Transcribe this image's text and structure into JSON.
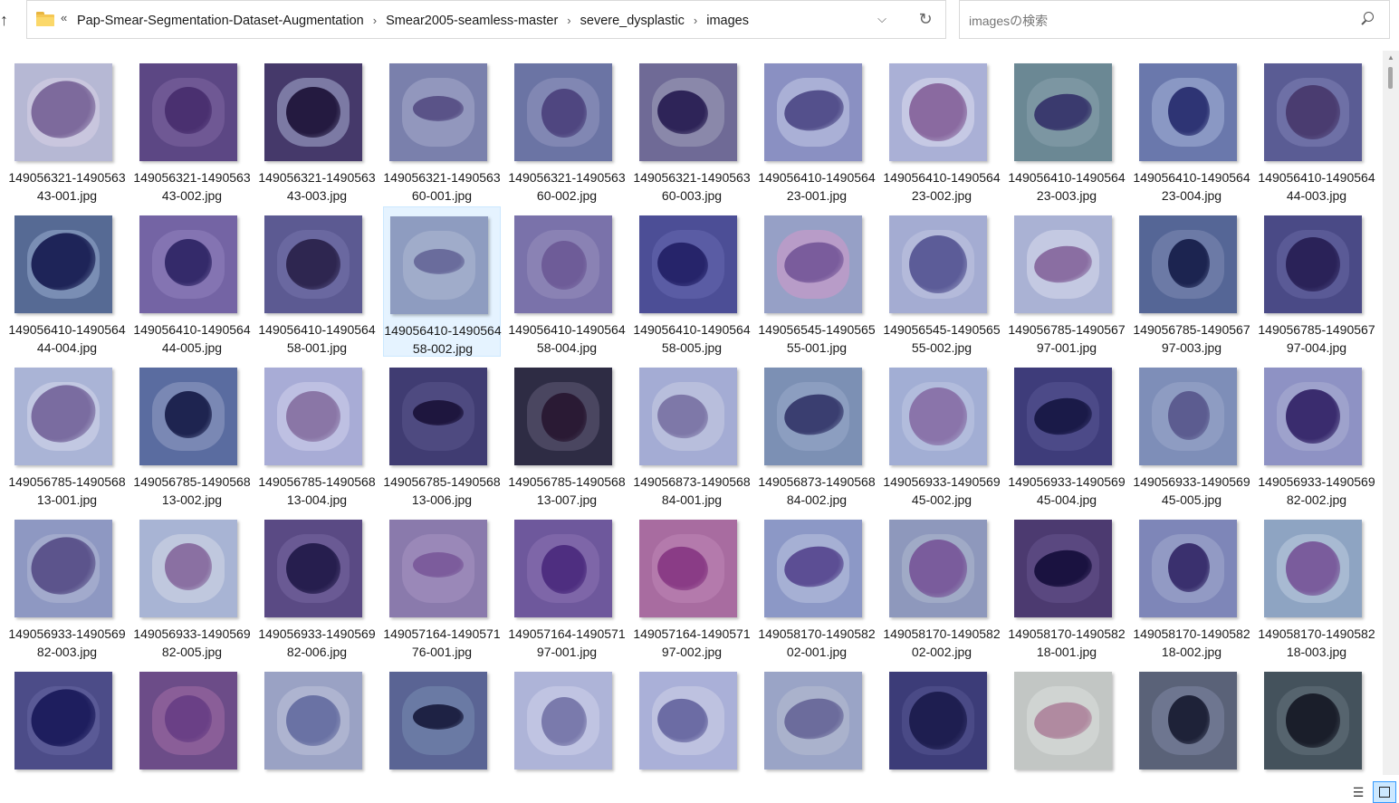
{
  "toolbar": {
    "up_icon": "up-arrow-icon",
    "overflow_chevron": "«",
    "breadcrumb": [
      "Pap-Smear-Segmentation-Dataset-Augmentation",
      "Smear2005-seamless-master",
      "severe_dysplastic",
      "images"
    ],
    "search_placeholder": "imagesの検索"
  },
  "view": {
    "mode": "large-icons",
    "selected_index": 14
  },
  "files": [
    {
      "name": "149056321-149056343-001.jpg",
      "bg": "#b6b8d4",
      "cell": "#c9c6de",
      "nuc": "#7d6a9c"
    },
    {
      "name": "149056321-149056343-002.jpg",
      "bg": "#5c4784",
      "cell": "#6f5894",
      "nuc": "#4a3070"
    },
    {
      "name": "149056321-149056343-003.jpg",
      "bg": "#45396a",
      "cell": "#7c7aa4",
      "nuc": "#241a40"
    },
    {
      "name": "149056321-149056360-001.jpg",
      "bg": "#7a80ac",
      "cell": "#9297bd",
      "nuc": "#5a5388"
    },
    {
      "name": "149056321-149056360-002.jpg",
      "bg": "#6b74a4",
      "cell": "#8187b3",
      "nuc": "#4f4680"
    },
    {
      "name": "149056321-149056360-003.jpg",
      "bg": "#6f6a96",
      "cell": "#8a88aa",
      "nuc": "#2e2458"
    },
    {
      "name": "149056410-149056423-001.jpg",
      "bg": "#8a90c2",
      "cell": "#aab0d6",
      "nuc": "#54508c"
    },
    {
      "name": "149056410-149056423-002.jpg",
      "bg": "#aab0d6",
      "cell": "#c6c9e4",
      "nuc": "#8a6aa0"
    },
    {
      "name": "149056410-149056423-003.jpg",
      "bg": "#6b8894",
      "cell": "#7c96a2",
      "nuc": "#3a3a6e"
    },
    {
      "name": "149056410-149056423-004.jpg",
      "bg": "#6a78ac",
      "cell": "#8a98c4",
      "nuc": "#2e3474"
    },
    {
      "name": "149056410-149056444-003.jpg",
      "bg": "#5a5c94",
      "cell": "#6e70a6",
      "nuc": "#4a3c70"
    },
    {
      "name": "149056410-149056444-004.jpg",
      "bg": "#566a94",
      "cell": "#7a8eb4",
      "nuc": "#1e2458"
    },
    {
      "name": "149056410-149056444-005.jpg",
      "bg": "#7464a4",
      "cell": "#8474b2",
      "nuc": "#342a6a"
    },
    {
      "name": "149056410-149056458-001.jpg",
      "bg": "#5c5a92",
      "cell": "#6a68a0",
      "nuc": "#2e2650"
    },
    {
      "name": "149056410-149056458-002.jpg",
      "bg": "#8e9cc0",
      "cell": "#a0acca",
      "nuc": "#6a6c9c"
    },
    {
      "name": "149056410-149056458-004.jpg",
      "bg": "#7a72aa",
      "cell": "#8a82b4",
      "nuc": "#6e5c98"
    },
    {
      "name": "149056410-149056458-005.jpg",
      "bg": "#4c4e96",
      "cell": "#5a5ca4",
      "nuc": "#26246a"
    },
    {
      "name": "149056545-149056555-001.jpg",
      "bg": "#96a0c6",
      "cell": "#b89cc8",
      "nuc": "#7a5c9c"
    },
    {
      "name": "149056545-149056555-002.jpg",
      "bg": "#a4acd2",
      "cell": "#b4bada",
      "nuc": "#5c5c98"
    },
    {
      "name": "149056785-149056797-001.jpg",
      "bg": "#aab2d4",
      "cell": "#c4c9e2",
      "nuc": "#8a6ea2"
    },
    {
      "name": "149056785-149056797-003.jpg",
      "bg": "#556696",
      "cell": "#6c7aa6",
      "nuc": "#1c2450"
    },
    {
      "name": "149056785-149056797-004.jpg",
      "bg": "#4a4a86",
      "cell": "#5a5a96",
      "nuc": "#2a2258"
    },
    {
      "name": "149056785-149056813-001.jpg",
      "bg": "#aab4d6",
      "cell": "#c2c8e2",
      "nuc": "#7a6ca0"
    },
    {
      "name": "149056785-149056813-002.jpg",
      "bg": "#5a6ca0",
      "cell": "#7a88b4",
      "nuc": "#1e2450"
    },
    {
      "name": "149056785-149056813-004.jpg",
      "bg": "#a8acd6",
      "cell": "#bec0e2",
      "nuc": "#8a76a6"
    },
    {
      "name": "149056785-149056813-006.jpg",
      "bg": "#403c72",
      "cell": "#4e4a80",
      "nuc": "#1e163e"
    },
    {
      "name": "149056785-149056813-007.jpg",
      "bg": "#2e2c44",
      "cell": "#4a4660",
      "nuc": "#2a1a34"
    },
    {
      "name": "149056873-149056884-001.jpg",
      "bg": "#a4acd4",
      "cell": "#b8bedc",
      "nuc": "#7e78a8"
    },
    {
      "name": "149056873-149056884-002.jpg",
      "bg": "#7c90b4",
      "cell": "#8c9ec0",
      "nuc": "#3a3e70"
    },
    {
      "name": "149056933-149056945-002.jpg",
      "bg": "#a2aed4",
      "cell": "#b2bcdc",
      "nuc": "#8a74aa"
    },
    {
      "name": "149056933-149056945-004.jpg",
      "bg": "#3e3c7a",
      "cell": "#4c4a88",
      "nuc": "#1a1a48"
    },
    {
      "name": "149056933-149056945-005.jpg",
      "bg": "#7e8eb8",
      "cell": "#8e9cc2",
      "nuc": "#5c5c90"
    },
    {
      "name": "149056933-149056982-002.jpg",
      "bg": "#8e92c4",
      "cell": "#9ea2cc",
      "nuc": "#3a2c6e"
    },
    {
      "name": "149056933-149056982-003.jpg",
      "bg": "#8e98c2",
      "cell": "#a2aacc",
      "nuc": "#5c548c"
    },
    {
      "name": "149056933-149056982-005.jpg",
      "bg": "#a8b4d4",
      "cell": "#c0c8de",
      "nuc": "#8a70a2"
    },
    {
      "name": "149056933-149056982-006.jpg",
      "bg": "#5a4a84",
      "cell": "#6a5a94",
      "nuc": "#261e4e"
    },
    {
      "name": "149057164-149057176-001.jpg",
      "bg": "#8a7aac",
      "cell": "#9a88b8",
      "nuc": "#7c5c9c"
    },
    {
      "name": "149057164-149057197-001.jpg",
      "bg": "#6e589c",
      "cell": "#7e66a8",
      "nuc": "#4e2e80"
    },
    {
      "name": "149057164-149057197-002.jpg",
      "bg": "#a86ca0",
      "cell": "#b47aac",
      "nuc": "#8a3c86"
    },
    {
      "name": "149058170-149058202-001.jpg",
      "bg": "#8c98c6",
      "cell": "#a6b0d4",
      "nuc": "#5c4e94"
    },
    {
      "name": "149058170-149058202-002.jpg",
      "bg": "#8e98bc",
      "cell": "#a0aac6",
      "nuc": "#7a5c9c"
    },
    {
      "name": "149058170-149058218-001.jpg",
      "bg": "#4c3a70",
      "cell": "#5a4880",
      "nuc": "#1a1240"
    },
    {
      "name": "149058170-149058218-002.jpg",
      "bg": "#7e86b8",
      "cell": "#929ac4",
      "nuc": "#3a306e"
    },
    {
      "name": "149058170-149058218-003.jpg",
      "bg": "#8ea4c2",
      "cell": "#a8bad2",
      "nuc": "#7a5c9c"
    },
    {
      "name": "",
      "bg": "#4c4c88",
      "cell": "#5a5a96",
      "nuc": "#1e1e5e"
    },
    {
      "name": "",
      "bg": "#6c4c88",
      "cell": "#8a5e98",
      "nuc": "#6a4086"
    },
    {
      "name": "",
      "bg": "#9aa2c4",
      "cell": "#aeb4d0",
      "nuc": "#6a72a4"
    },
    {
      "name": "",
      "bg": "#5a6494",
      "cell": "#6a7aa4",
      "nuc": "#1e2244"
    },
    {
      "name": "",
      "bg": "#aeb4d8",
      "cell": "#c0c4e2",
      "nuc": "#7a7aac"
    },
    {
      "name": "",
      "bg": "#aab0d8",
      "cell": "#bec2e0",
      "nuc": "#6c6ca4"
    },
    {
      "name": "",
      "bg": "#9aa4c6",
      "cell": "#aab2cc",
      "nuc": "#6c6c9c"
    },
    {
      "name": "",
      "bg": "#3c3c78",
      "cell": "#4a4a86",
      "nuc": "#1e1e50"
    },
    {
      "name": "",
      "bg": "#c2c6c4",
      "cell": "#d0d4d2",
      "nuc": "#b08aa0"
    },
    {
      "name": "",
      "bg": "#5a6278",
      "cell": "#6e7690",
      "nuc": "#1e2238"
    },
    {
      "name": "",
      "bg": "#44525c",
      "cell": "#56646e",
      "nuc": "#1a1e2a"
    }
  ]
}
